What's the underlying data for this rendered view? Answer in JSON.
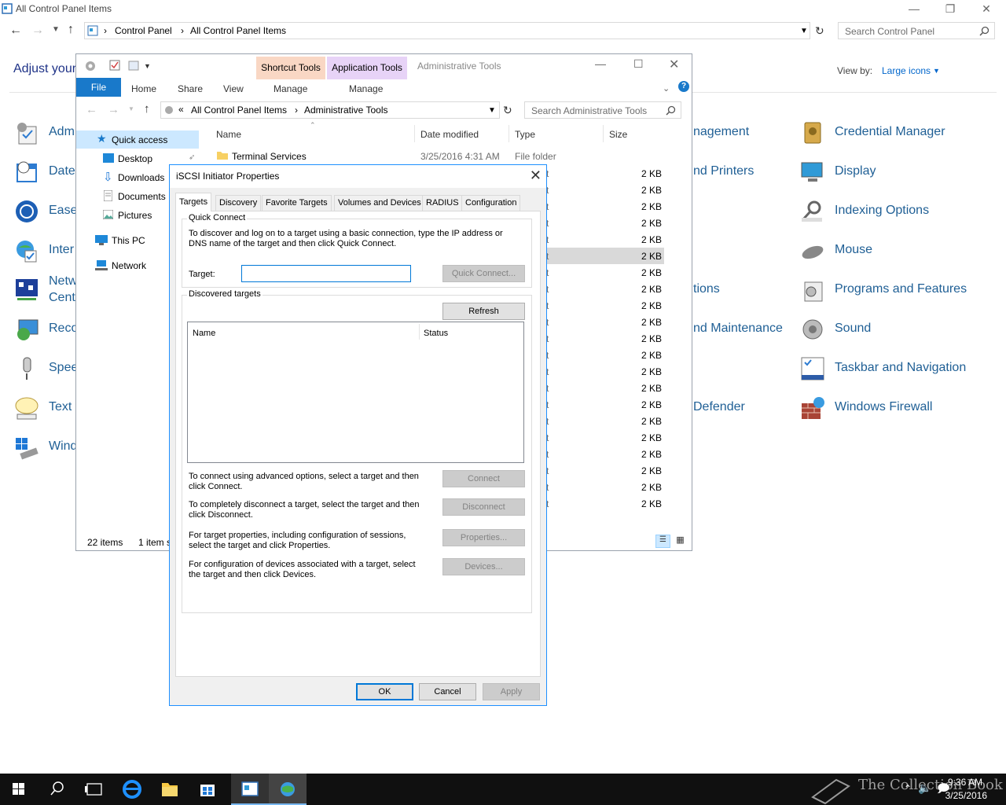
{
  "control_panel": {
    "title": "All Control Panel Items",
    "breadcrumb": [
      "Control Panel",
      "All Control Panel Items"
    ],
    "search_placeholder": "Search Control Panel",
    "heading": "Adjust your",
    "view_by_label": "View by:",
    "view_by_value": "Large icons",
    "left_items": [
      "Adm",
      "Date",
      "Ease",
      "Inter",
      "Netw",
      "Cente",
      "Reco",
      "Spee",
      "Text t",
      "Wind"
    ],
    "mid_items": [
      "nagement",
      "nd Printers",
      "tions",
      "nd Maintenance",
      "Defender"
    ],
    "right_items": [
      "Credential Manager",
      "Display",
      "Indexing Options",
      "Mouse",
      "Programs and Features",
      "Sound",
      "Taskbar and Navigation",
      "Windows Firewall"
    ]
  },
  "explorer": {
    "title": "Administrative Tools",
    "context_tabs": {
      "shortcut": "Shortcut Tools",
      "application": "Application Tools"
    },
    "ribbon_tabs": {
      "file": "File",
      "home": "Home",
      "share": "Share",
      "view": "View",
      "manage1": "Manage",
      "manage2": "Manage"
    },
    "address": {
      "prefix": "«",
      "crumbs": [
        "All Control Panel Items",
        "Administrative Tools"
      ]
    },
    "search_placeholder": "Search Administrative Tools",
    "nav": {
      "quick_access": "Quick access",
      "desktop": "Desktop",
      "downloads": "Downloads",
      "documents": "Documents",
      "pictures": "Pictures",
      "this_pc": "This PC",
      "network": "Network"
    },
    "columns": {
      "name": "Name",
      "date": "Date modified",
      "type": "Type",
      "size": "Size"
    },
    "first_row": {
      "name": "Terminal Services",
      "date": "3/25/2016 4:31 AM",
      "type": "File folder"
    },
    "size_value": "2 KB",
    "type_suffix": "t",
    "status": {
      "items": "22 items",
      "selected": "1 item s"
    }
  },
  "dialog": {
    "title": "iSCSI Initiator Properties",
    "tabs": [
      "Targets",
      "Discovery",
      "Favorite Targets",
      "Volumes and Devices",
      "RADIUS",
      "Configuration"
    ],
    "quick_connect": {
      "label": "Quick Connect",
      "description": "To discover and log on to a target using a basic connection, type the IP address or DNS name of the target and then click Quick Connect.",
      "target_label": "Target:",
      "target_value": "",
      "button": "Quick Connect..."
    },
    "discovered": {
      "label": "Discovered targets",
      "refresh": "Refresh",
      "col_name": "Name",
      "col_status": "Status"
    },
    "actions": [
      {
        "text": "To connect using advanced options, select a target and then click Connect.",
        "button": "Connect"
      },
      {
        "text": "To completely disconnect a target, select the target and then click Disconnect.",
        "button": "Disconnect"
      },
      {
        "text": "For target properties, including configuration of sessions, select the target and click Properties.",
        "button": "Properties..."
      },
      {
        "text": "For configuration of devices associated with a target, select the target and then click Devices.",
        "button": "Devices..."
      }
    ],
    "ok": "OK",
    "cancel": "Cancel",
    "apply": "Apply"
  },
  "taskbar": {
    "time": "9:36 AM",
    "date": "3/25/2016",
    "watermark": "The Collection Book"
  },
  "colors": {
    "accent": "#0078d7",
    "link": "#1f5f95",
    "shortcut_tab": "#f9d7c4",
    "application_tab": "#e7d3f7",
    "taskbar": "#101010"
  }
}
